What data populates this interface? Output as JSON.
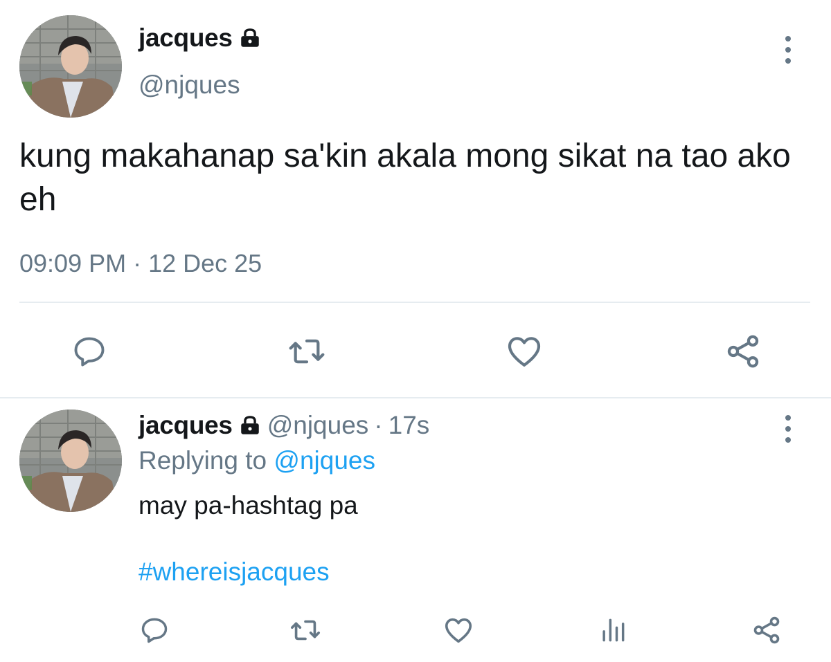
{
  "main_tweet": {
    "display_name": "jacques",
    "handle": "@njques",
    "text": "kung makahanap sa'kin akala mong sikat na tao ako eh",
    "timestamp": "09:09 PM",
    "separator": "·",
    "date": "12 Dec 25",
    "icons": [
      "lock-icon",
      "more-icon",
      "reply-icon",
      "retweet-icon",
      "like-icon",
      "share-icon"
    ]
  },
  "reply_tweet": {
    "display_name": "jacques",
    "handle": "@njques",
    "separator": "·",
    "time_ago": "17s",
    "replying_prefix": "Replying to",
    "replying_handle": "@njques",
    "text": "may pa-hashtag pa",
    "hashtag": "#whereisjacques",
    "icons": [
      "lock-icon",
      "more-icon",
      "reply-icon",
      "retweet-icon",
      "like-icon",
      "analytics-icon",
      "share-icon"
    ]
  },
  "colors": {
    "text": "#14171a",
    "secondary": "#657786",
    "link": "#1da1f2",
    "divider": "#e6ecf0"
  }
}
